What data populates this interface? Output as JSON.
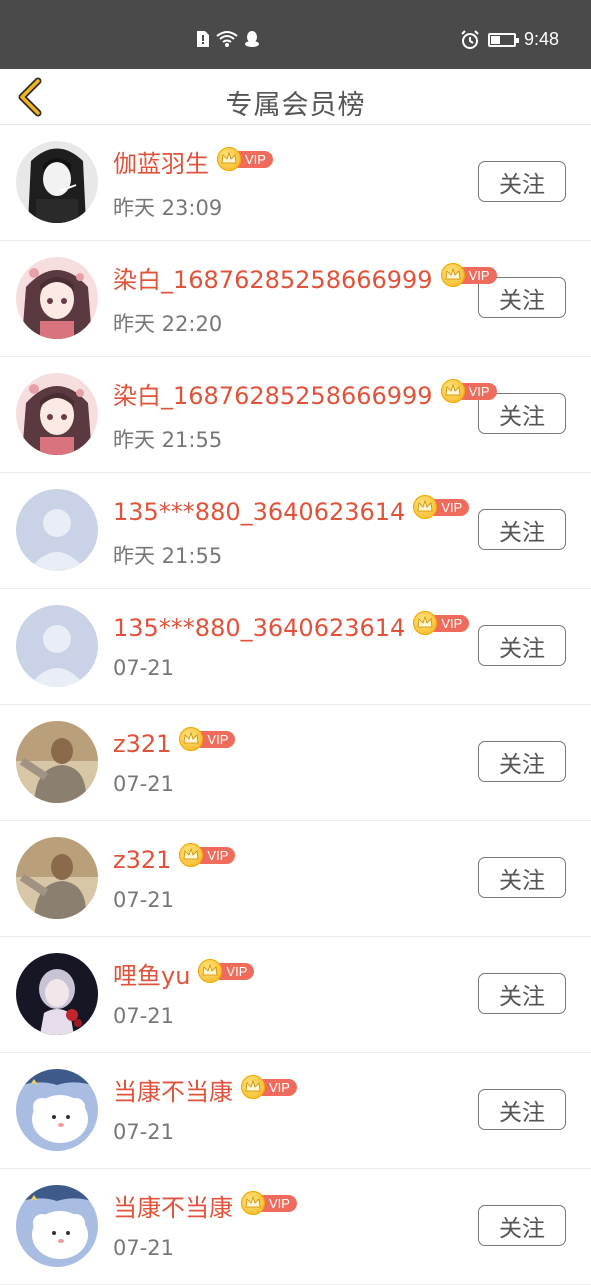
{
  "status_bar": {
    "time": "9:48",
    "icons": [
      "sim-alert-icon",
      "wifi-icon",
      "qq-icon",
      "alarm-icon",
      "battery-icon"
    ],
    "battery_level": 0.4
  },
  "header": {
    "title": "专属会员榜",
    "back_icon": "chevron-left-icon",
    "accent_color": "#f2b51c"
  },
  "colors": {
    "name": "#e0533a",
    "vip_badge": "#ef6b5c",
    "crown": "#f5b21a"
  },
  "vip_label": "VIP",
  "follow_label": "关注",
  "members": [
    {
      "name": "伽蓝羽生",
      "time": "昨天 23:09",
      "avatar": "anime-boy-avatar"
    },
    {
      "name": "染白_16876285258666999",
      "time": "昨天 22:20",
      "avatar": "anime-girl-avatar"
    },
    {
      "name": "染白_16876285258666999",
      "time": "昨天 21:55",
      "avatar": "anime-girl-avatar"
    },
    {
      "name": "135***880_3640623614",
      "time": "昨天 21:55",
      "avatar": "default-avatar"
    },
    {
      "name": "135***880_3640623614",
      "time": "07-21",
      "avatar": "default-avatar"
    },
    {
      "name": "z321",
      "time": "07-21",
      "avatar": "photo-avatar"
    },
    {
      "name": "z321",
      "time": "07-21",
      "avatar": "photo-avatar"
    },
    {
      "name": "哩鱼yu",
      "time": "07-21",
      "avatar": "anime-rose-avatar"
    },
    {
      "name": "当康不当康",
      "time": "07-21",
      "avatar": "cartoon-sheep-avatar"
    },
    {
      "name": "当康不当康",
      "time": "07-21",
      "avatar": "cartoon-sheep-avatar"
    }
  ]
}
